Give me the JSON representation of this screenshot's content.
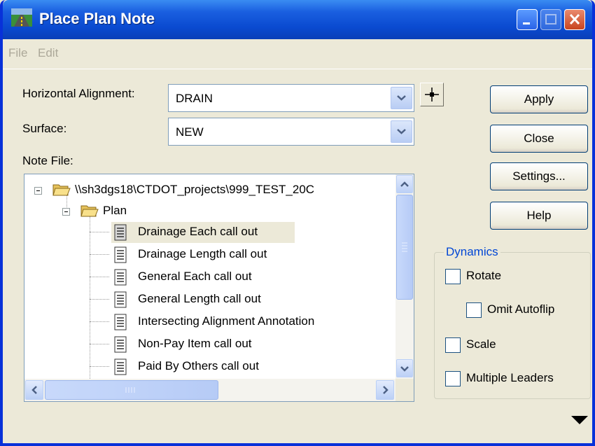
{
  "window": {
    "title": "Place Plan Note"
  },
  "menu": [
    "File",
    "Edit"
  ],
  "form": {
    "horizontal_alignment_label": "Horizontal Alignment:",
    "horizontal_alignment_value": "DRAIN",
    "surface_label": "Surface:",
    "surface_value": "NEW",
    "note_file_label": "Note File:"
  },
  "buttons": {
    "apply": "Apply",
    "close": "Close",
    "settings": "Settings...",
    "help": "Help"
  },
  "tree": {
    "root": "\\\\sh3dgs18\\CTDOT_projects\\999_TEST_20C",
    "folder": "Plan",
    "items": [
      "Drainage Each call out",
      "Drainage Length call out",
      "General Each call out",
      "General Length call out",
      "Intersecting Alignment Annotation",
      "Non-Pay Item call out",
      "Paid By Others call out"
    ],
    "selected_index": 0
  },
  "dynamics": {
    "title": "Dynamics",
    "rotate": "Rotate",
    "omit_autoflip": "Omit Autoflip",
    "scale": "Scale",
    "multiple_leaders": "Multiple Leaders"
  },
  "colors": {
    "title_bar": "#0a4ad0",
    "window_bg": "#ece9d8",
    "selected_bg": "#ece9d8",
    "group_title": "#0046d5"
  }
}
